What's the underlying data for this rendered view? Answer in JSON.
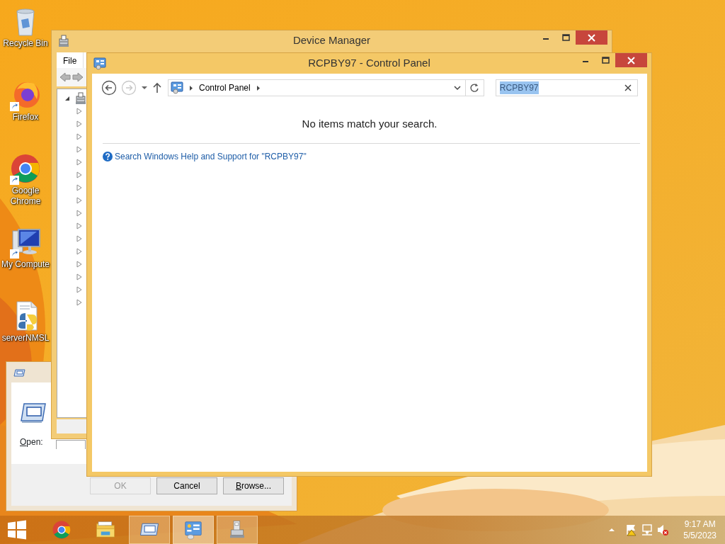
{
  "desktop_icons": [
    {
      "label": "Recycle Bin",
      "kind": "recycle",
      "shortcut": false
    },
    {
      "label": "Firefox",
      "kind": "firefox",
      "shortcut": true
    },
    {
      "label": "Google Chrome",
      "kind": "chrome",
      "shortcut": true
    },
    {
      "label": "My Compute",
      "kind": "computer",
      "shortcut": true
    },
    {
      "label": "serverNMSL",
      "kind": "python",
      "shortcut": false
    }
  ],
  "run_dialog": {
    "open_label": "Open:",
    "open_access_key_underlined": true,
    "buttons": [
      {
        "label": "OK",
        "disabled": true,
        "access_key_underlined": false
      },
      {
        "label": "Cancel",
        "disabled": false,
        "access_key_underlined": false
      },
      {
        "label": "Browse...",
        "disabled": false,
        "access_key_underlined": true
      }
    ]
  },
  "device_manager": {
    "title": "Device Manager",
    "menu": [
      "File"
    ],
    "tree": {
      "expanded": true,
      "children": [
        {
          "expanded": false
        },
        {
          "expanded": false
        },
        {
          "expanded": false
        },
        {
          "expanded": false
        },
        {
          "expanded": false
        },
        {
          "expanded": false
        },
        {
          "expanded": false
        },
        {
          "expanded": false
        },
        {
          "expanded": false
        },
        {
          "expanded": false
        },
        {
          "expanded": false
        },
        {
          "expanded": false
        },
        {
          "expanded": false
        },
        {
          "expanded": false
        },
        {
          "expanded": false
        },
        {
          "expanded": false
        }
      ]
    }
  },
  "control_panel": {
    "title": "RCPBY97 - Control Panel",
    "forward_disabled": true,
    "breadcrumb": [
      "Control Panel"
    ],
    "search": {
      "value": "RCPBY97",
      "selected": true
    },
    "message": "No items match your search.",
    "help_link": "Search Windows Help and Support for \"RCPBY97\""
  },
  "taskbar": {
    "items": [
      {
        "kind": "chrome",
        "open": false,
        "selected": false
      },
      {
        "kind": "explorer",
        "open": false,
        "selected": false
      },
      {
        "kind": "run",
        "open": true,
        "selected": false
      },
      {
        "kind": "control-panel",
        "open": true,
        "selected": true
      },
      {
        "kind": "device-manager",
        "open": true,
        "selected": false
      }
    ],
    "time": "9:17 AM",
    "date": "5/5/2023"
  }
}
